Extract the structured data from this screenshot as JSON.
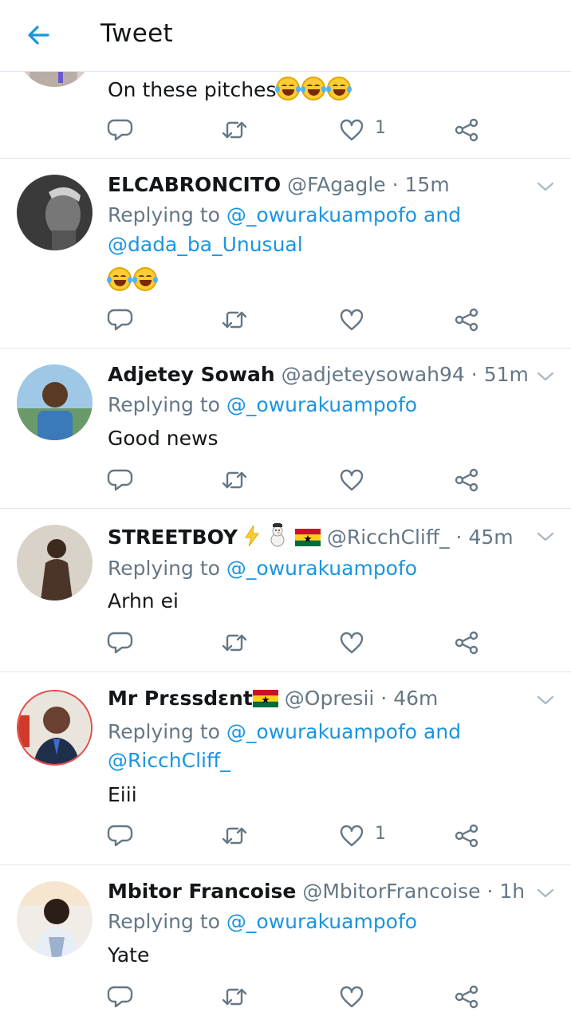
{
  "header": {
    "back_icon": "arrow-left-icon",
    "title": "Tweet"
  },
  "colors": {
    "accent": "#1b95e0",
    "secondary_text": "#657786",
    "divider": "#e1e8ed"
  },
  "first_tweet": {
    "text": "On these pitches",
    "emoji": [
      "rolling-laughing-emoji",
      "rolling-laughing-emoji",
      "rolling-laughing-emoji"
    ],
    "like_count": "1"
  },
  "replies": [
    {
      "name": "ELCABRONCITO",
      "handle": "@FAgagle",
      "dot": "·",
      "time": "15m",
      "replying_prefix": "Replying to",
      "mention1": "@_owurakuampofo",
      "conj": "and",
      "mention2": "@dada_ba_Unusual",
      "text": "",
      "emoji": [
        "joy-emoji",
        "joy-emoji"
      ],
      "like_count": ""
    },
    {
      "name": "Adjetey Sowah",
      "handle": "@adjeteysowah94",
      "dot": "·",
      "time": "51m",
      "replying_prefix": "Replying to",
      "mention1": "@_owurakuampofo",
      "text": "Good news",
      "like_count": ""
    },
    {
      "name": "STREETBOY",
      "name_emoji": [
        "lightning-emoji",
        "snowman-emoji",
        "ghana-flag-emoji"
      ],
      "handle": "@RicchCliff_",
      "dot": "·",
      "time": "45m",
      "replying_prefix": "Replying to",
      "mention1": "@_owurakuampofo",
      "text": "Arhn ei",
      "like_count": ""
    },
    {
      "name": "Mr Prɛssdɛnt",
      "name_emoji": [
        "ghana-flag-emoji"
      ],
      "handle": "@Opresii",
      "dot": "·",
      "time": "46m",
      "replying_prefix": "Replying to",
      "mention1": "@_owurakuampofo",
      "conj": "and",
      "mention2": "@RicchCliff_",
      "text": "Eiii",
      "like_count": "1"
    },
    {
      "name": "Mbitor Francoise",
      "handle": "@MbitorFrancoise",
      "dot": "·",
      "time": "1h",
      "replying_prefix": "Replying to",
      "mention1": "@_owurakuampofo",
      "text": "Yate",
      "like_count": ""
    }
  ]
}
